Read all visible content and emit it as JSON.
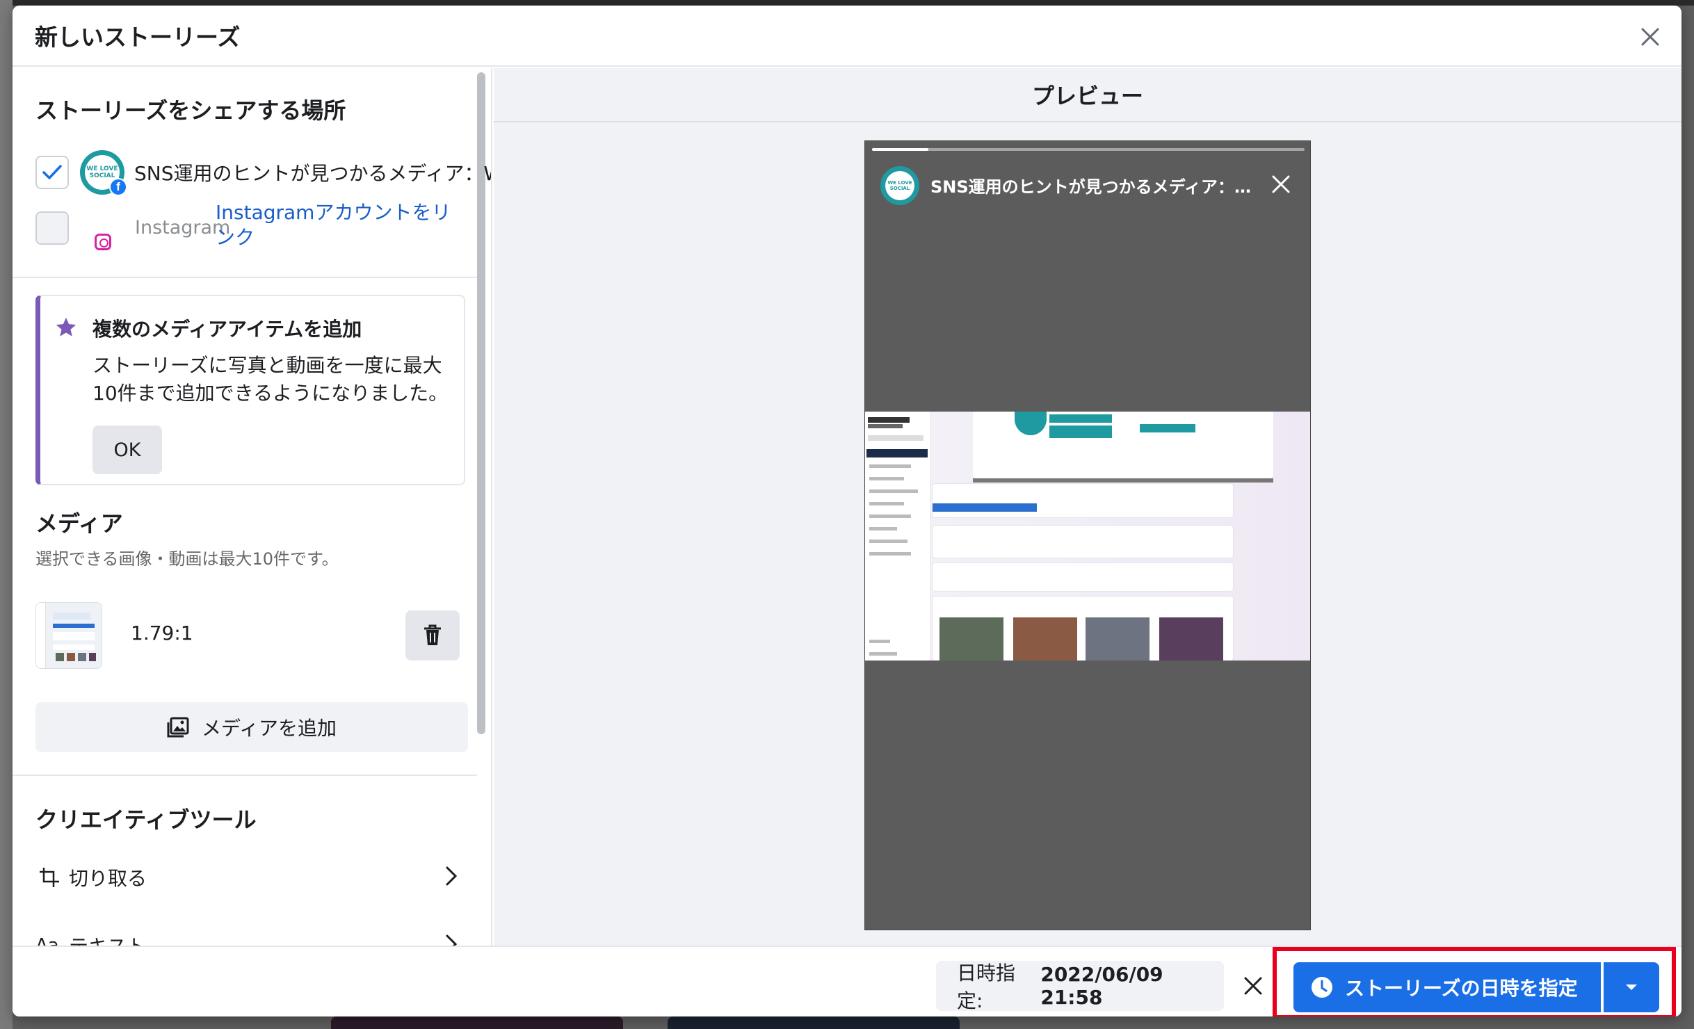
{
  "modal": {
    "title": "新しいストーリーズ"
  },
  "share": {
    "title": "ストーリーズをシェアする場所",
    "facebook_account": "SNS運用のヒントが見つかるメディア：W",
    "instagram_label": "Instagram",
    "instagram_link": "Instagramアカウントをリンク"
  },
  "tip": {
    "title": "複数のメディアアイテムを追加",
    "body": "ストーリーズに写真と動画を一度に最大10件まで追加できるようになりました。",
    "ok_label": "OK"
  },
  "media": {
    "title": "メディア",
    "subtitle": "選択できる画像・動画は最大10件です。",
    "item_ratio": "1.79:1",
    "add_label": "メディアを追加"
  },
  "tools": {
    "title": "クリエイティブツール",
    "items": [
      {
        "icon": "crop-icon",
        "label": "切り取る"
      },
      {
        "icon": "text-icon",
        "label": "テキスト"
      }
    ]
  },
  "preview": {
    "title": "プレビュー",
    "story_name": "SNS運用のヒントが見つかるメディア：W...",
    "story_progress": 0.13
  },
  "footer": {
    "schedule_prefix": "日時指定:",
    "schedule_value": "2022/06/09 21:58",
    "primary_label": "ストーリーズの日時を指定"
  },
  "colors": {
    "primary": "#1a6ee6",
    "highlight": "#e8001c",
    "tip_accent": "#7b5ab6",
    "link": "#1a5dc8"
  }
}
